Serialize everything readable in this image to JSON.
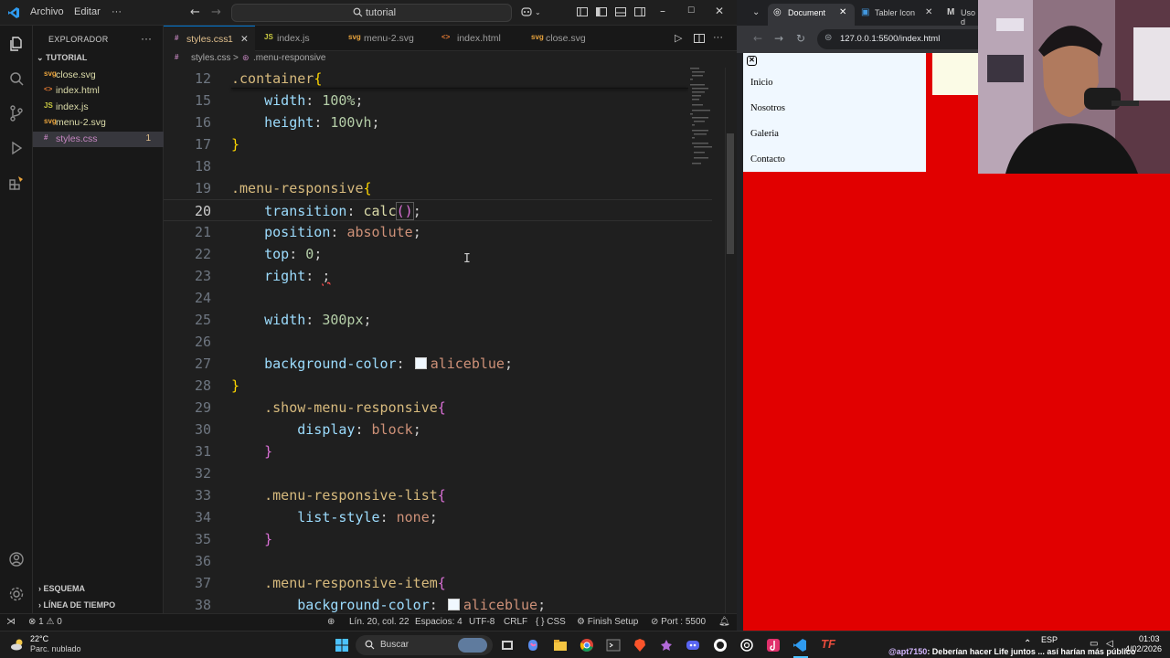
{
  "vscode": {
    "menu": [
      "Archivo",
      "Editar",
      "···"
    ],
    "search": "tutorial",
    "sidebar": {
      "title": "EXPLORADOR",
      "folder": "TUTORIAL",
      "files": [
        {
          "icon": "svg",
          "name": "close.svg",
          "badge": ""
        },
        {
          "icon": "<>",
          "name": "index.html",
          "badge": ""
        },
        {
          "icon": "JS",
          "name": "index.js",
          "badge": ""
        },
        {
          "icon": "svg",
          "name": "menu-2.svg",
          "badge": ""
        },
        {
          "icon": "#",
          "name": "styles.css",
          "badge": "1"
        }
      ],
      "outline": "ESQUEMA",
      "timeline": "LÍNEA DE TIEMPO"
    },
    "tabs": [
      {
        "icon": "#",
        "label": "styles.css",
        "badge": "1"
      },
      {
        "icon": "JS",
        "label": "index.js",
        "badge": ""
      },
      {
        "icon": "svg",
        "label": "menu-2.svg",
        "badge": ""
      },
      {
        "icon": "<>",
        "label": "index.html",
        "badge": ""
      },
      {
        "icon": "svg",
        "label": "close.svg",
        "badge": ""
      }
    ],
    "breadcrumb": {
      "file": "styles.css",
      "sep": ">",
      "symbol": ".menu-responsive"
    },
    "lines": [
      {
        "n": "12"
      },
      {
        "n": "15"
      },
      {
        "n": "16"
      },
      {
        "n": "17"
      },
      {
        "n": "18"
      },
      {
        "n": "19"
      },
      {
        "n": "20"
      },
      {
        "n": "21"
      },
      {
        "n": "22"
      },
      {
        "n": "23"
      },
      {
        "n": "24"
      },
      {
        "n": "25"
      },
      {
        "n": "26"
      },
      {
        "n": "27"
      },
      {
        "n": "28"
      },
      {
        "n": "29"
      },
      {
        "n": "30"
      },
      {
        "n": "31"
      },
      {
        "n": "32"
      },
      {
        "n": "33"
      },
      {
        "n": "34"
      },
      {
        "n": "35"
      },
      {
        "n": "36"
      },
      {
        "n": "37"
      },
      {
        "n": "38"
      }
    ],
    "code": {
      "l12_sel": ".container",
      "l15_prop": "width",
      "l15_val": "100%",
      "l16_prop": "height",
      "l16_val": "100vh",
      "l19_sel": ".menu-responsive",
      "l20_prop": "transition",
      "l20_fn": "calc",
      "l21_prop": "position",
      "l21_val": "absolute",
      "l22_prop": "top",
      "l22_val": "0",
      "l23_prop": "right",
      "l25_prop": "width",
      "l25_val": "300px",
      "l27_prop": "background-color",
      "l27_val": "aliceblue",
      "l29_sel": ".show-menu-responsive",
      "l30_prop": "display",
      "l30_val": "block",
      "l33_sel": ".menu-responsive-list",
      "l34_prop": "list-style",
      "l34_val": "none",
      "l37_sel": ".menu-responsive-item",
      "l38_prop": "background-color",
      "l38_val": "aliceblue"
    },
    "status": {
      "errors": "1",
      "warnings": "0",
      "position": "Lín. 20, col. 22",
      "spaces": "Espacios: 4",
      "encoding": "UTF-8",
      "eol": "CRLF",
      "language": "CSS",
      "finish": "Finish Setup",
      "port": "Port : 5500"
    }
  },
  "browser": {
    "tabs": [
      "Document",
      "Tabler Icons",
      "Uso d"
    ],
    "url": "127.0.0.1:5500/index.html",
    "menu_items": [
      "Inicio",
      "Nosotros",
      "Galeria",
      "Contacto"
    ],
    "page_color": "#e10000",
    "panel_color": "#f0f8ff"
  },
  "taskbar": {
    "weather_temp": "22°C",
    "weather_desc": "Parc. nublado",
    "search": "Buscar",
    "lang": "ESP",
    "time": "01:03",
    "date": "4/02/2026",
    "ticker_user": "@apt7150",
    "ticker_text": ": Deberían hacer Life juntos ... así harían más público"
  }
}
